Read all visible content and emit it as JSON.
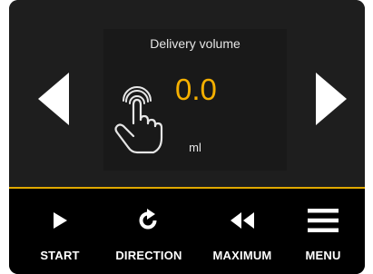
{
  "display": {
    "parameter_title": "Delivery volume",
    "value": "0.0",
    "unit": "ml"
  },
  "navigation": {
    "prev_icon": "triangle-left",
    "next_icon": "triangle-right"
  },
  "toolbar": {
    "start_label": "START",
    "direction_label": "DIRECTION",
    "maximum_label": "MAXIMUM",
    "menu_label": "MENU"
  },
  "colors": {
    "background": "#1e1e1e",
    "value_accent": "#f5b000",
    "divider": "#e0a800",
    "toolbar_background": "#000000",
    "icon": "#ffffff"
  }
}
